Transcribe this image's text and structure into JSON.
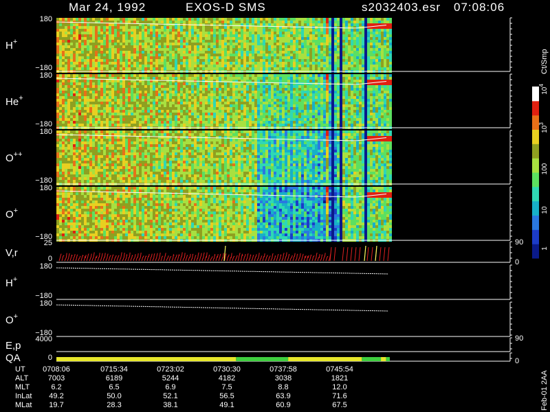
{
  "header": {
    "date": "Mar 24, 1992",
    "instrument": "EXOS-D SMS",
    "file": "s2032403.esr",
    "time": "07:08:06"
  },
  "colors": {
    "background": "#000000",
    "text": "#ffffff",
    "qa_yellow": "#e6e62a",
    "qa_green": "#3fcf3f",
    "speed_line": "#e02020"
  },
  "chart_data": {
    "type": "heatmap",
    "panels": [
      {
        "label": "H",
        "sup": "+",
        "ymax": "180",
        "ymin": "−180",
        "kind": "spectrogram"
      },
      {
        "label": "He",
        "sup": "+",
        "ymax": "180",
        "ymin": "−180",
        "kind": "spectrogram"
      },
      {
        "label": "O",
        "sup": "++",
        "ymax": "180",
        "ymin": "−180",
        "kind": "spectrogram"
      },
      {
        "label": "O",
        "sup": "+",
        "ymax": "180",
        "ymin": "−180",
        "kind": "spectrogram"
      },
      {
        "label": "V,r",
        "sup": "",
        "ymax": "25",
        "ymin": "0",
        "rmax": "90",
        "rmin": "0",
        "kind": "lines"
      },
      {
        "label": "H",
        "sup": "+",
        "ymax": "180",
        "ymin": "−180",
        "kind": "trace"
      },
      {
        "label": "O",
        "sup": "+",
        "ymax": "180",
        "ymin": "−180",
        "kind": "trace"
      },
      {
        "label": "E,p",
        "sup": "",
        "ymax": "4000",
        "ymin": "",
        "rmax": "90",
        "rmin": "",
        "kind": "empty"
      },
      {
        "label": "QA",
        "sup": "",
        "ymax": "",
        "ymin": "0",
        "rmax": "",
        "rmin": "0",
        "kind": "empty"
      }
    ],
    "colorbar": {
      "title": "Ct/Smp",
      "labels": [
        "1",
        "10",
        "100",
        "10",
        "10"
      ],
      "superscripts": [
        "",
        "",
        "",
        "3",
        "4"
      ]
    },
    "qa_bar": [
      {
        "from": "0708:06",
        "to": "0731:40",
        "status": "yellow"
      },
      {
        "from": "0731:40",
        "to": "0738:30",
        "status": "green"
      },
      {
        "from": "0738:30",
        "to": "0748:10",
        "status": "yellow"
      },
      {
        "from": "0748:10",
        "to": "0750:40",
        "status": "green"
      },
      {
        "from": "0750:40",
        "to": "0751:20",
        "status": "yellow"
      },
      {
        "from": "0751:20",
        "to": "0751:50",
        "status": "green"
      }
    ],
    "time_axis": {
      "row_labels": [
        "UT",
        "ALT",
        "MLT",
        "InLat",
        "MLat"
      ],
      "columns": [
        {
          "UT": "0708:06",
          "ALT": "7003",
          "MLT": "6.2",
          "InLat": "49.2",
          "MLat": "19.7"
        },
        {
          "UT": "0715:34",
          "ALT": "6189",
          "MLT": "6.5",
          "InLat": "50.0",
          "MLat": "28.3"
        },
        {
          "UT": "0723:02",
          "ALT": "5244",
          "MLT": "6.9",
          "InLat": "52.1",
          "MLat": "38.1"
        },
        {
          "UT": "0730:30",
          "ALT": "4182",
          "MLT": "7.5",
          "InLat": "56.5",
          "MLat": "49.1"
        },
        {
          "UT": "0737:58",
          "ALT": "3038",
          "MLT": "8.8",
          "InLat": "63.9",
          "MLat": "60.9"
        },
        {
          "UT": "0745:54",
          "ALT": "1821",
          "MLT": "12.0",
          "InLat": "71.6",
          "MLat": "67.5"
        }
      ]
    }
  },
  "side_note": "Feb-01 2AA"
}
